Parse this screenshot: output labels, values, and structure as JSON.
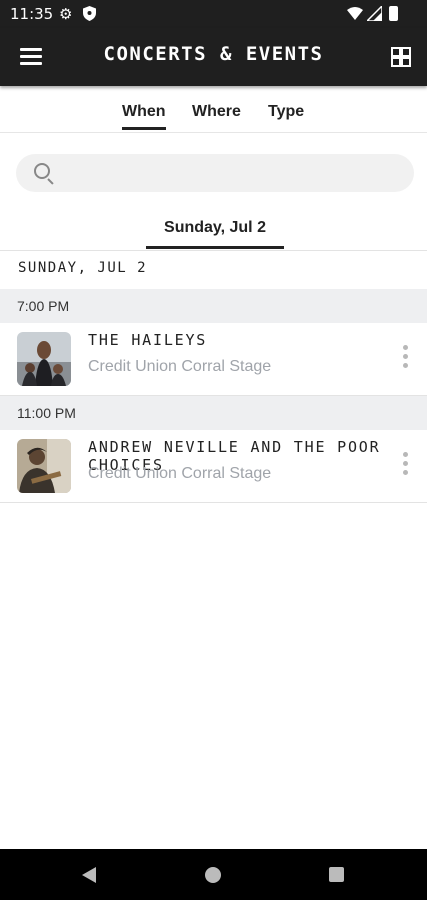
{
  "status": {
    "time": "11:35"
  },
  "header": {
    "title": "CONCERTS & EVENTS"
  },
  "tabs": [
    {
      "label": "When",
      "active": true
    },
    {
      "label": "Where",
      "active": false
    },
    {
      "label": "Type",
      "active": false
    }
  ],
  "search": {
    "placeholder": ""
  },
  "date_tab": {
    "label": "Sunday, Jul 2"
  },
  "day_header": "SUNDAY, JUL 2",
  "groups": [
    {
      "time": "7:00 PM",
      "event": {
        "name": "THE HAILEYS",
        "venue": "Credit Union Corral Stage"
      }
    },
    {
      "time": "11:00 PM",
      "event": {
        "name": "ANDREW NEVILLE AND THE POOR CHOICES",
        "venue": "Credit Union Corral Stage"
      }
    }
  ]
}
